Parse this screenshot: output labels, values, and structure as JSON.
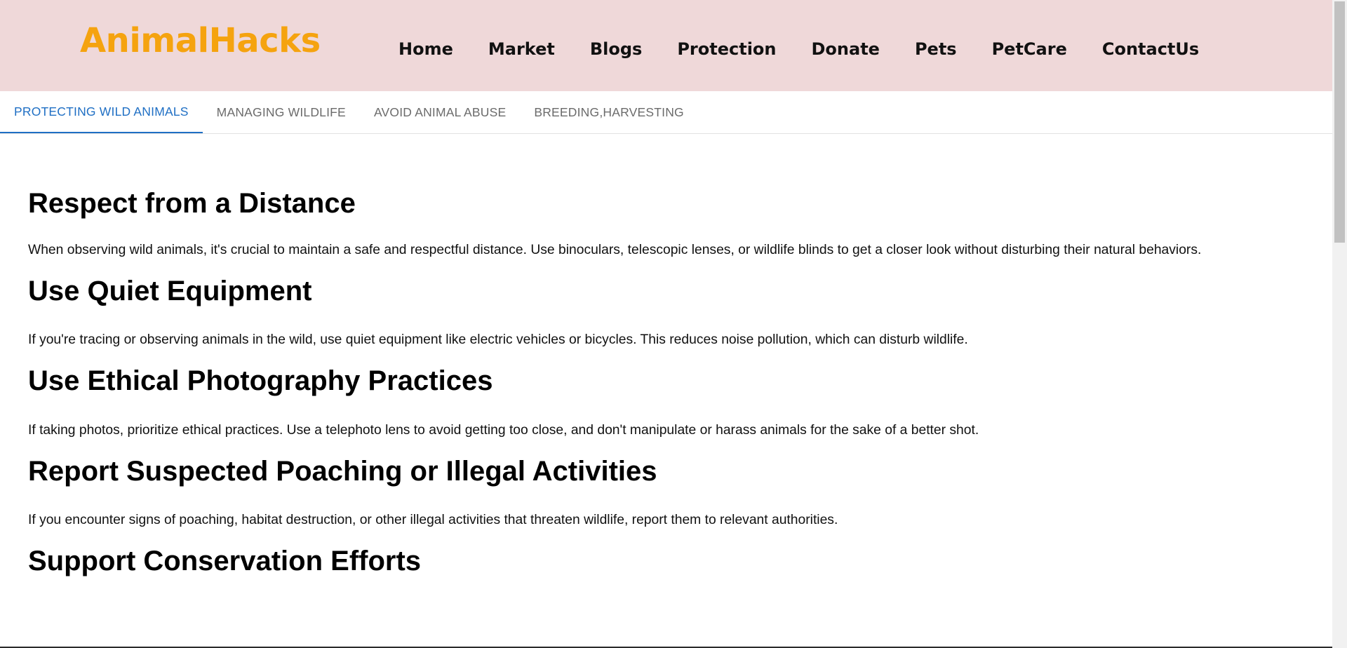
{
  "header": {
    "logo": "AnimalHacks",
    "nav": [
      "Home",
      "Market",
      "Blogs",
      "Protection",
      "Donate",
      "Pets",
      "PetCare",
      "ContactUs"
    ]
  },
  "tabs": [
    {
      "label": "PROTECTING WILD ANIMALS",
      "active": true
    },
    {
      "label": "MANAGING WILDLIFE",
      "active": false
    },
    {
      "label": "AVOID ANIMAL ABUSE",
      "active": false
    },
    {
      "label": "BREEDING,HARVESTING",
      "active": false
    }
  ],
  "sections": [
    {
      "title": "Respect from a Distance",
      "text": "When observing wild animals, it's crucial to maintain a safe and respectful distance. Use binoculars, telescopic lenses, or wildlife blinds to get a closer look without disturbing their natural behaviors."
    },
    {
      "title": "Use Quiet Equipment",
      "text": "If you're tracing or observing animals in the wild, use quiet equipment like electric vehicles or bicycles. This reduces noise pollution, which can disturb wildlife."
    },
    {
      "title": "Use Ethical Photography Practices",
      "text": "If taking photos, prioritize ethical practices. Use a telephoto lens to avoid getting too close, and don't manipulate or harass animals for the sake of a better shot."
    },
    {
      "title": "Report Suspected Poaching or Illegal Activities",
      "text": "If you encounter signs of poaching, habitat destruction, or other illegal activities that threaten wildlife, report them to relevant authorities."
    },
    {
      "title": "Support Conservation Efforts",
      "text": ""
    }
  ],
  "colors": {
    "header_bg": "#efd8d9",
    "logo": "#f5a30f",
    "active_tab": "#1f6fc4"
  }
}
